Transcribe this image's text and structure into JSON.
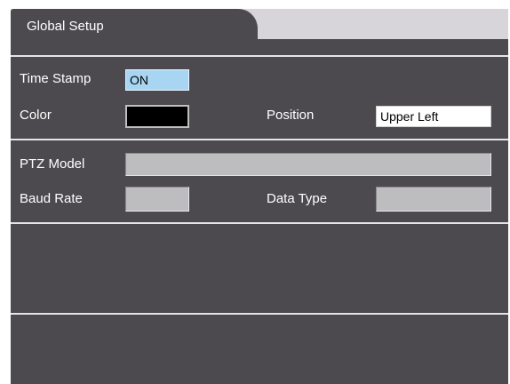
{
  "tab": {
    "label": "Global Setup"
  },
  "time_stamp": {
    "label": "Time Stamp",
    "value": "ON"
  },
  "color": {
    "label": "Color",
    "value": "",
    "swatch": "#000000"
  },
  "position": {
    "label": "Position",
    "value": "Upper Left"
  },
  "ptz_model": {
    "label": "PTZ Model",
    "value": ""
  },
  "baud_rate": {
    "label": "Baud Rate",
    "value": ""
  },
  "data_type": {
    "label": "Data Type",
    "value": ""
  }
}
